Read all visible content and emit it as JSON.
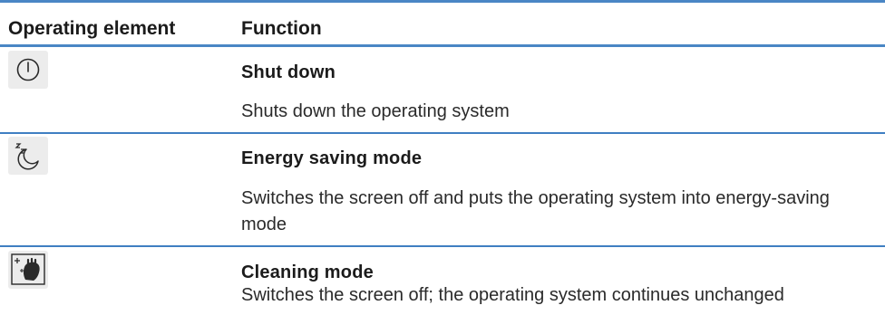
{
  "table": {
    "headers": {
      "col1": "Operating element",
      "col2": "Function"
    },
    "rows": [
      {
        "icon": "power-icon",
        "title": "Shut down",
        "description": "Shuts down the operating system"
      },
      {
        "icon": "sleep-moon-icon",
        "title": "Energy saving mode",
        "description": "Switches the screen off and puts the operating system into energy-saving mode"
      },
      {
        "icon": "cleaning-hand-icon",
        "title": "Cleaning mode",
        "description": "Switches the screen off; the operating system continues unchanged"
      }
    ]
  },
  "colors": {
    "rule": "#4a86c5",
    "icon_background": "#ececec"
  }
}
